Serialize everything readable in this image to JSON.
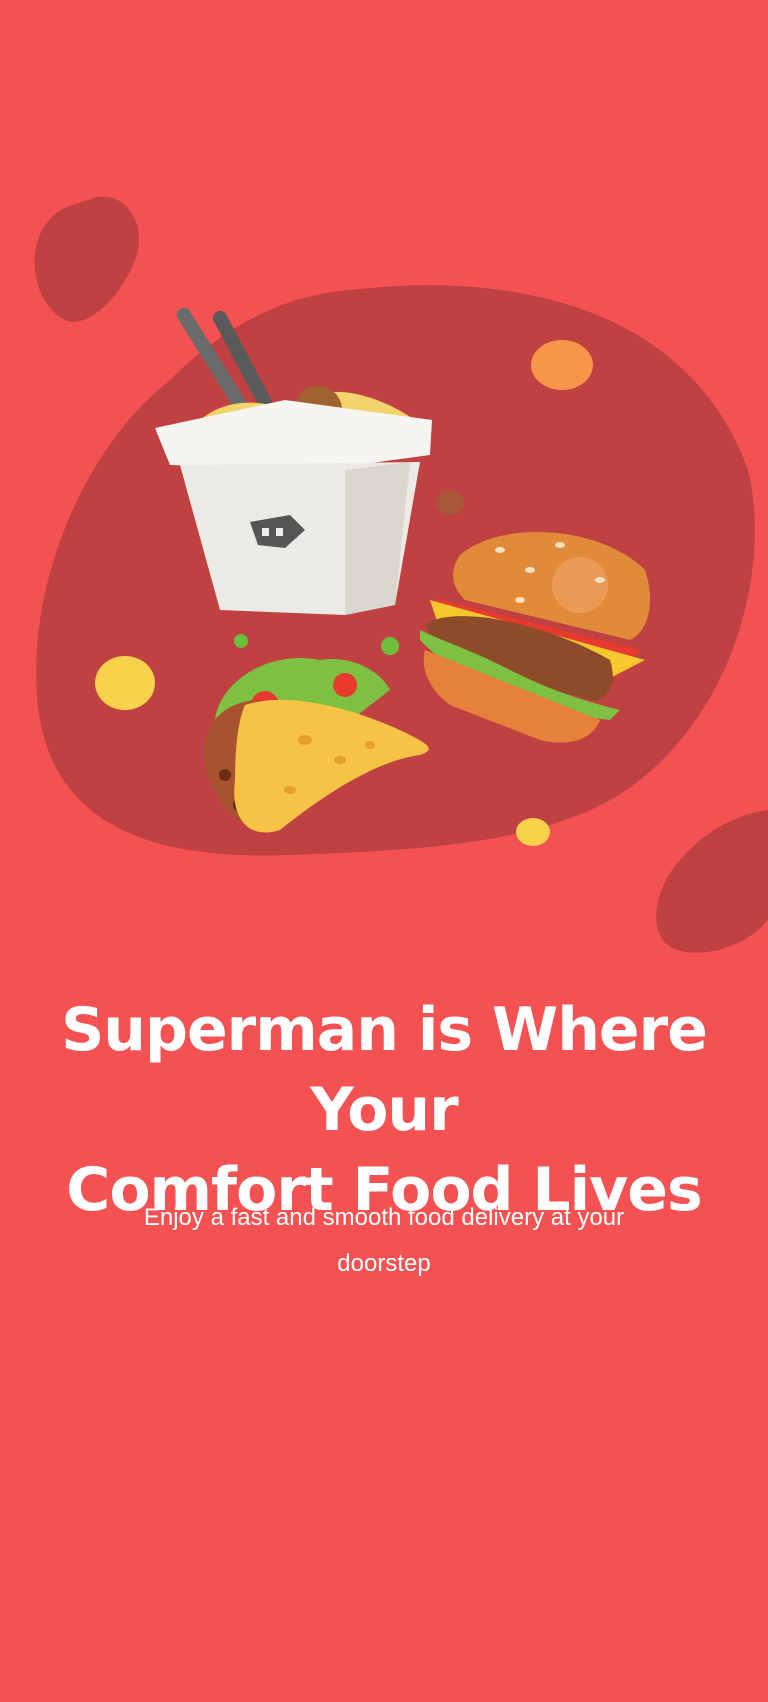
{
  "screen": {
    "background_color": "#F45252",
    "accent_dark": "#C04141",
    "headline": {
      "line1": "Superman is Where Your",
      "line2": "Comfort Food Lives"
    },
    "subtitle": {
      "line1": "Enjoy a fast and smooth food delivery at your",
      "line2": "doorstep"
    },
    "illustration": {
      "items": [
        "noodle-box-icon",
        "burger-icon",
        "taco-icon"
      ]
    }
  }
}
